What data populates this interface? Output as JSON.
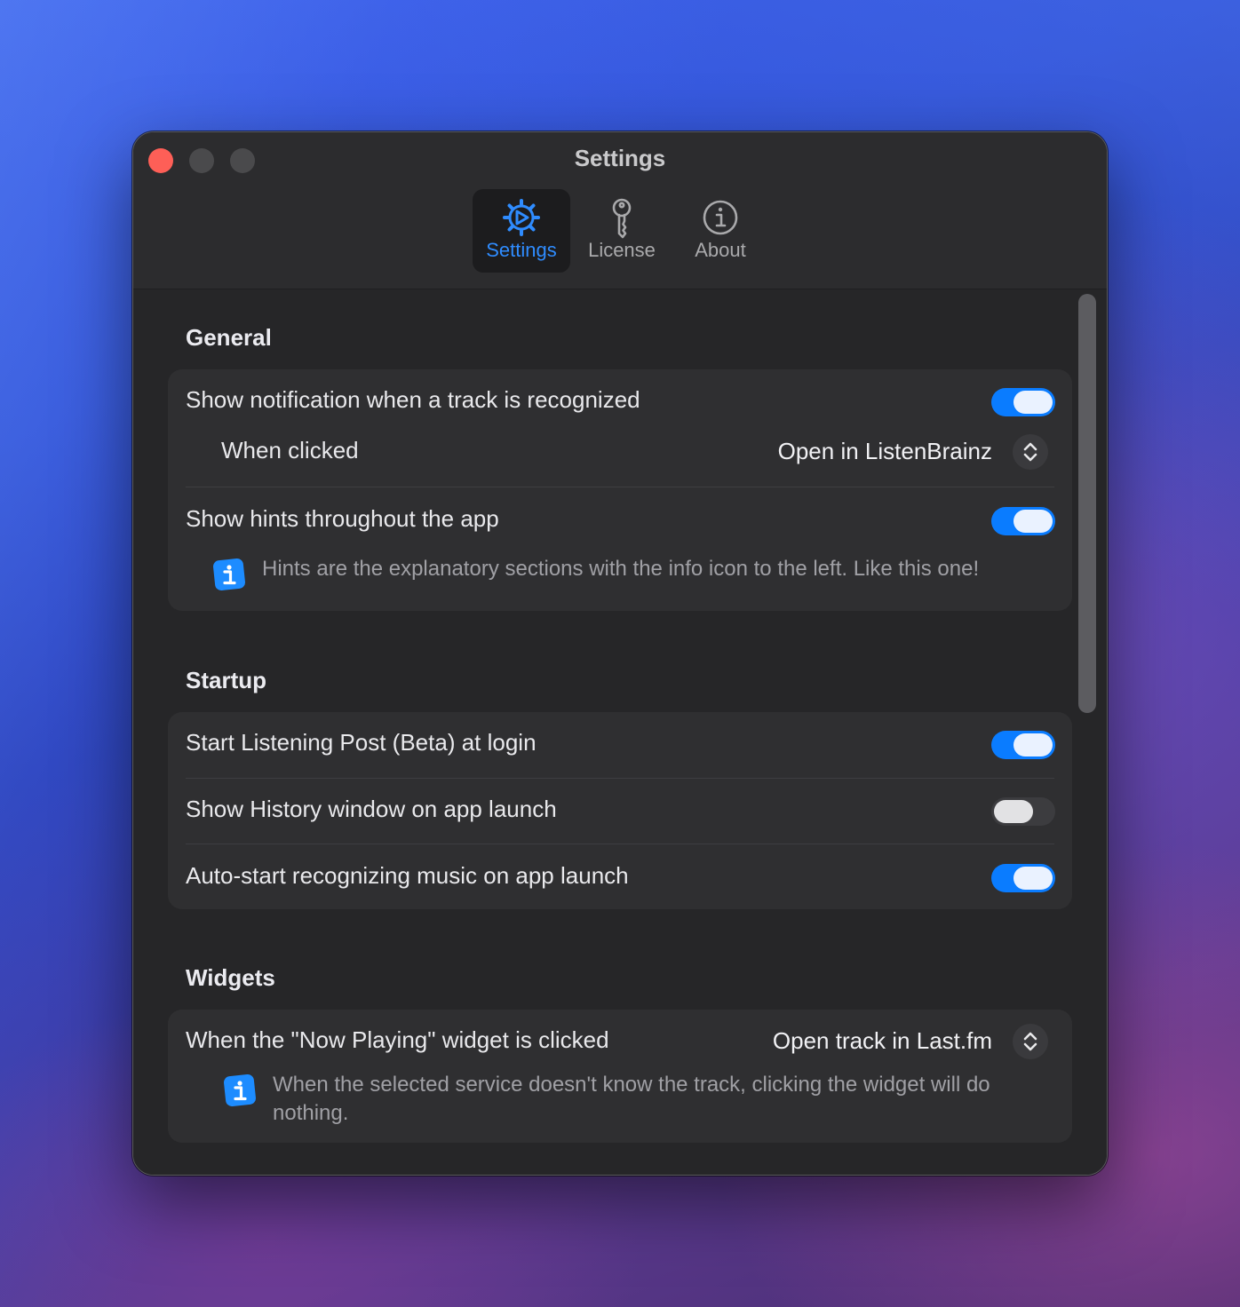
{
  "window": {
    "title": "Settings",
    "accent_color": "#0a7cff"
  },
  "tabs": [
    {
      "label": "Settings",
      "icon": "gear-icon",
      "active": true
    },
    {
      "label": "License",
      "icon": "key-icon",
      "active": false
    },
    {
      "label": "About",
      "icon": "info-circle-icon",
      "active": false
    }
  ],
  "general": {
    "title": "General",
    "show_notification": {
      "label": "Show notification when a track is recognized",
      "enabled": true
    },
    "when_clicked": {
      "label": "When clicked",
      "value": "Open in ListenBrainz"
    },
    "show_hints": {
      "label": "Show hints throughout the app",
      "enabled": true
    },
    "hint": "Hints are the explanatory sections with the info icon to the left. Like this one!"
  },
  "startup": {
    "title": "Startup",
    "start_at_login": {
      "label": "Start Listening Post (Beta) at login",
      "enabled": true
    },
    "show_history": {
      "label": "Show History window on app launch",
      "enabled": false
    },
    "auto_start": {
      "label": "Auto-start recognizing music on app launch",
      "enabled": true
    }
  },
  "widgets": {
    "title": "Widgets",
    "now_playing_click": {
      "label": "When the \"Now Playing\" widget is clicked",
      "value": "Open track in Last.fm"
    },
    "hint": "When the selected service doesn't know the track, clicking the widget will do nothing."
  }
}
